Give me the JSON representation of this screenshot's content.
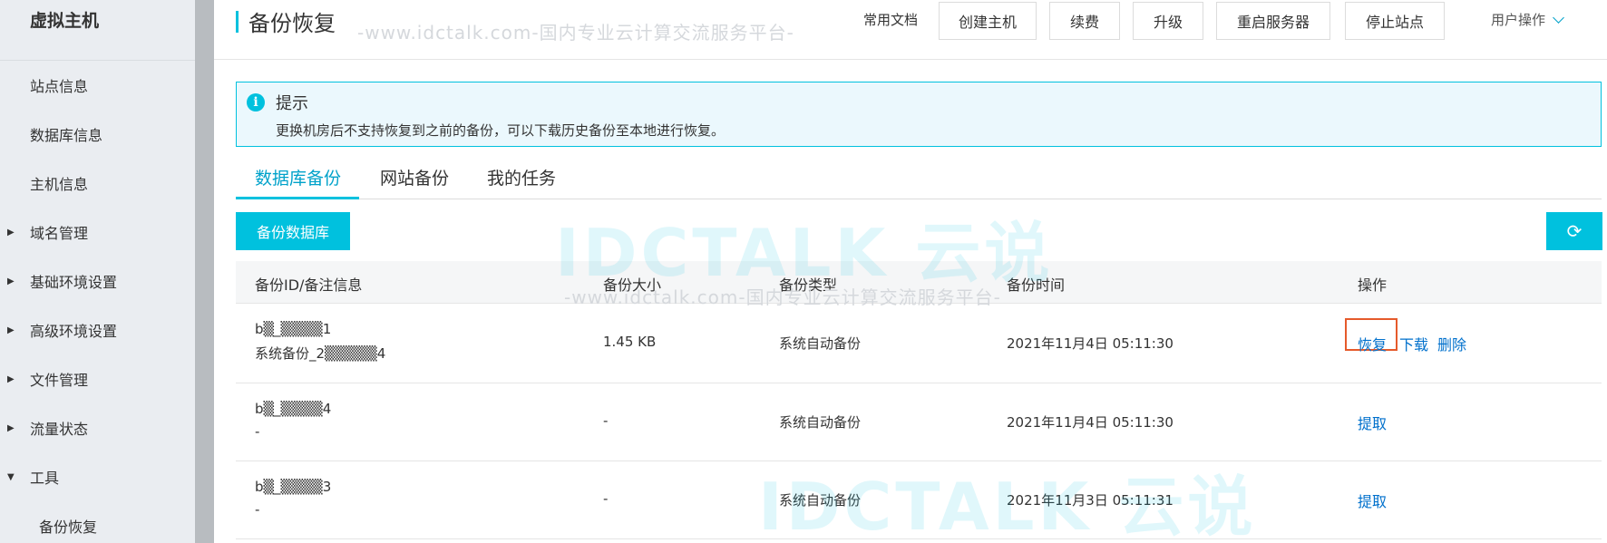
{
  "sidebar": {
    "title": "虚拟主机",
    "items": [
      {
        "label": "站点信息",
        "caret": ""
      },
      {
        "label": "数据库信息",
        "caret": ""
      },
      {
        "label": "主机信息",
        "caret": ""
      },
      {
        "label": "域名管理",
        "caret": "▶"
      },
      {
        "label": "基础环境设置",
        "caret": "▶"
      },
      {
        "label": "高级环境设置",
        "caret": "▶"
      },
      {
        "label": "文件管理",
        "caret": "▶"
      },
      {
        "label": "流量状态",
        "caret": "▶"
      },
      {
        "label": "工具",
        "caret": "▼"
      },
      {
        "label": "备份恢复",
        "caret": ""
      }
    ]
  },
  "header": {
    "title": "备份恢复",
    "docs_link": "常用文档",
    "buttons": [
      "创建主机",
      "续费",
      "升级",
      "重启服务器",
      "停止站点"
    ],
    "user_menu": "用户操作"
  },
  "alert": {
    "icon": "i",
    "title": "提示",
    "text": "更换机房后不支持恢复到之前的备份，可以下载历史备份至本地进行恢复。"
  },
  "tabs": [
    "数据库备份",
    "网站备份",
    "我的任务"
  ],
  "toolbar": {
    "backup_button": "备份数据库",
    "refresh_icon": "⟳"
  },
  "table": {
    "columns": [
      "备份ID/备注信息",
      "备份大小",
      "备份类型",
      "备份时间",
      "操作"
    ],
    "rows": [
      {
        "id": "b▒_▒▒▒▒1",
        "note": "系统备份_2▒▒▒▒▒4",
        "size": "1.45 KB",
        "type": "系统自动备份",
        "time": "2021年11月4日 05:11:30",
        "actions": [
          "恢复",
          "下载",
          "删除"
        ]
      },
      {
        "id": "b▒_▒▒▒▒4",
        "note": "-",
        "size": "-",
        "type": "系统自动备份",
        "time": "2021年11月4日 05:11:30",
        "actions": [
          "提取"
        ]
      },
      {
        "id": "b▒_▒▒▒▒3",
        "note": "-",
        "size": "-",
        "type": "系统自动备份",
        "time": "2021年11月3日 05:11:31",
        "actions": [
          "提取"
        ]
      }
    ]
  },
  "watermark": {
    "url_text": "-www.idctalk.com-国内专业云计算交流服务平台-",
    "logo_text": "IDCTALK 云说"
  },
  "colors": {
    "accent": "#00c1de",
    "link": "#0070cc",
    "highlight": "#e55a2b"
  }
}
